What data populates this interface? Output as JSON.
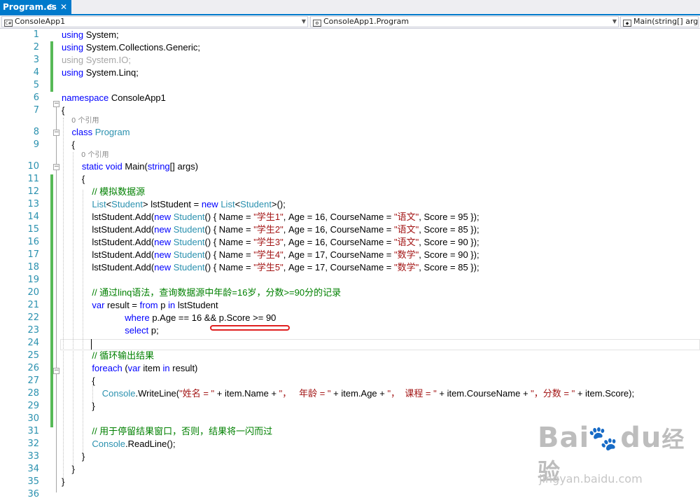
{
  "tab": {
    "title": "Program.cs",
    "pin_glyph": "⊕",
    "close_glyph": "✕"
  },
  "navbar": {
    "project_icon_text": "C#",
    "project": "ConsoleApp1",
    "type_member": "ConsoleApp1.Program",
    "method": "Main(string[] args)"
  },
  "codelens": [
    "0 个引用",
    "0 个引用"
  ],
  "lines": [
    {
      "n": "1",
      "t": [
        {
          "c": "kw",
          "s": "using"
        },
        {
          "c": "",
          "s": " System;"
        }
      ]
    },
    {
      "n": "2",
      "t": [
        {
          "c": "kw",
          "s": "using"
        },
        {
          "c": "",
          "s": " System.Collections.Generic;"
        }
      ]
    },
    {
      "n": "3",
      "t": [
        {
          "c": "dim",
          "s": "using System.IO;"
        }
      ]
    },
    {
      "n": "4",
      "t": [
        {
          "c": "kw",
          "s": "using"
        },
        {
          "c": "",
          "s": " System.Linq;"
        }
      ]
    },
    {
      "n": "5",
      "t": []
    },
    {
      "n": "6",
      "t": [
        {
          "c": "kw",
          "s": "namespace"
        },
        {
          "c": "",
          "s": " ConsoleApp1"
        }
      ]
    },
    {
      "n": "7",
      "t": [
        {
          "c": "",
          "s": "{"
        }
      ]
    },
    {
      "n": "8",
      "t": [
        {
          "c": "",
          "s": "    "
        },
        {
          "c": "kw",
          "s": "class"
        },
        {
          "c": "",
          "s": " "
        },
        {
          "c": "ty",
          "s": "Program"
        }
      ]
    },
    {
      "n": "9",
      "t": [
        {
          "c": "",
          "s": "    {"
        }
      ]
    },
    {
      "n": "10",
      "t": [
        {
          "c": "",
          "s": "        "
        },
        {
          "c": "kw",
          "s": "static"
        },
        {
          "c": "",
          "s": " "
        },
        {
          "c": "kw",
          "s": "void"
        },
        {
          "c": "",
          "s": " Main("
        },
        {
          "c": "kw",
          "s": "string"
        },
        {
          "c": "",
          "s": "[] args)"
        }
      ]
    },
    {
      "n": "11",
      "t": [
        {
          "c": "",
          "s": "        {"
        }
      ]
    },
    {
      "n": "12",
      "t": [
        {
          "c": "",
          "s": "            "
        },
        {
          "c": "cm",
          "s": "// 模拟数据源"
        }
      ]
    },
    {
      "n": "13",
      "t": [
        {
          "c": "",
          "s": "            "
        },
        {
          "c": "ty",
          "s": "List"
        },
        {
          "c": "",
          "s": "<"
        },
        {
          "c": "ty",
          "s": "Student"
        },
        {
          "c": "",
          "s": "> lstStudent = "
        },
        {
          "c": "kw",
          "s": "new"
        },
        {
          "c": "",
          "s": " "
        },
        {
          "c": "ty",
          "s": "List"
        },
        {
          "c": "",
          "s": "<"
        },
        {
          "c": "ty",
          "s": "Student"
        },
        {
          "c": "",
          "s": ">();"
        }
      ]
    },
    {
      "n": "14",
      "t": [
        {
          "c": "",
          "s": "            lstStudent.Add("
        },
        {
          "c": "kw",
          "s": "new"
        },
        {
          "c": "",
          "s": " "
        },
        {
          "c": "ty",
          "s": "Student"
        },
        {
          "c": "",
          "s": "() { Name = "
        },
        {
          "c": "st",
          "s": "\"学生1\""
        },
        {
          "c": "",
          "s": ", Age = 16, CourseName = "
        },
        {
          "c": "st",
          "s": "\"语文\""
        },
        {
          "c": "",
          "s": ", Score = 95 });"
        }
      ]
    },
    {
      "n": "15",
      "t": [
        {
          "c": "",
          "s": "            lstStudent.Add("
        },
        {
          "c": "kw",
          "s": "new"
        },
        {
          "c": "",
          "s": " "
        },
        {
          "c": "ty",
          "s": "Student"
        },
        {
          "c": "",
          "s": "() { Name = "
        },
        {
          "c": "st",
          "s": "\"学生2\""
        },
        {
          "c": "",
          "s": ", Age = 16, CourseName = "
        },
        {
          "c": "st",
          "s": "\"语文\""
        },
        {
          "c": "",
          "s": ", Score = 85 });"
        }
      ]
    },
    {
      "n": "16",
      "t": [
        {
          "c": "",
          "s": "            lstStudent.Add("
        },
        {
          "c": "kw",
          "s": "new"
        },
        {
          "c": "",
          "s": " "
        },
        {
          "c": "ty",
          "s": "Student"
        },
        {
          "c": "",
          "s": "() { Name = "
        },
        {
          "c": "st",
          "s": "\"学生3\""
        },
        {
          "c": "",
          "s": ", Age = 16, CourseName = "
        },
        {
          "c": "st",
          "s": "\"语文\""
        },
        {
          "c": "",
          "s": ", Score = 90 });"
        }
      ]
    },
    {
      "n": "17",
      "t": [
        {
          "c": "",
          "s": "            lstStudent.Add("
        },
        {
          "c": "kw",
          "s": "new"
        },
        {
          "c": "",
          "s": " "
        },
        {
          "c": "ty",
          "s": "Student"
        },
        {
          "c": "",
          "s": "() { Name = "
        },
        {
          "c": "st",
          "s": "\"学生4\""
        },
        {
          "c": "",
          "s": ", Age = 17, CourseName = "
        },
        {
          "c": "st",
          "s": "\"数学\""
        },
        {
          "c": "",
          "s": ", Score = 90 });"
        }
      ]
    },
    {
      "n": "18",
      "t": [
        {
          "c": "",
          "s": "            lstStudent.Add("
        },
        {
          "c": "kw",
          "s": "new"
        },
        {
          "c": "",
          "s": " "
        },
        {
          "c": "ty",
          "s": "Student"
        },
        {
          "c": "",
          "s": "() { Name = "
        },
        {
          "c": "st",
          "s": "\"学生5\""
        },
        {
          "c": "",
          "s": ", Age = 17, CourseName = "
        },
        {
          "c": "st",
          "s": "\"数学\""
        },
        {
          "c": "",
          "s": ", Score = 85 });"
        }
      ]
    },
    {
      "n": "19",
      "t": []
    },
    {
      "n": "20",
      "t": [
        {
          "c": "",
          "s": "            "
        },
        {
          "c": "cm",
          "s": "// 通过linq语法，查询数据源中年龄=16岁，分数>=90分的记录"
        }
      ]
    },
    {
      "n": "21",
      "t": [
        {
          "c": "",
          "s": "            "
        },
        {
          "c": "kw",
          "s": "var"
        },
        {
          "c": "",
          "s": " result = "
        },
        {
          "c": "kw",
          "s": "from"
        },
        {
          "c": "",
          "s": " p "
        },
        {
          "c": "kw",
          "s": "in"
        },
        {
          "c": "",
          "s": " lstStudent"
        }
      ]
    },
    {
      "n": "22",
      "t": [
        {
          "c": "",
          "s": "                         "
        },
        {
          "c": "kw",
          "s": "where"
        },
        {
          "c": "",
          "s": " p.Age == 16 && p.Score >= 90"
        }
      ]
    },
    {
      "n": "23",
      "t": [
        {
          "c": "",
          "s": "                         "
        },
        {
          "c": "kw",
          "s": "select"
        },
        {
          "c": "",
          "s": " p;"
        }
      ]
    },
    {
      "n": "24",
      "t": []
    },
    {
      "n": "25",
      "t": [
        {
          "c": "",
          "s": "            "
        },
        {
          "c": "cm",
          "s": "// 循环输出结果"
        }
      ]
    },
    {
      "n": "26",
      "t": [
        {
          "c": "",
          "s": "            "
        },
        {
          "c": "kw",
          "s": "foreach"
        },
        {
          "c": "",
          "s": " ("
        },
        {
          "c": "kw",
          "s": "var"
        },
        {
          "c": "",
          "s": " item "
        },
        {
          "c": "kw",
          "s": "in"
        },
        {
          "c": "",
          "s": " result)"
        }
      ]
    },
    {
      "n": "27",
      "t": [
        {
          "c": "",
          "s": "            {"
        }
      ]
    },
    {
      "n": "28",
      "t": [
        {
          "c": "",
          "s": "                "
        },
        {
          "c": "ty",
          "s": "Console"
        },
        {
          "c": "",
          "s": ".WriteLine("
        },
        {
          "c": "st",
          "s": "\"姓名 = \""
        },
        {
          "c": "",
          "s": " + item.Name + "
        },
        {
          "c": "st",
          "s": "\"，   年龄 = \""
        },
        {
          "c": "",
          "s": " + item.Age + "
        },
        {
          "c": "st",
          "s": "\"，  课程 = \""
        },
        {
          "c": "",
          "s": " + item.CourseName + "
        },
        {
          "c": "st",
          "s": "\"，分数 = \""
        },
        {
          "c": "",
          "s": " + item.Score);"
        }
      ]
    },
    {
      "n": "29",
      "t": [
        {
          "c": "",
          "s": "            }"
        }
      ]
    },
    {
      "n": "30",
      "t": []
    },
    {
      "n": "31",
      "t": [
        {
          "c": "",
          "s": "            "
        },
        {
          "c": "cm",
          "s": "// 用于停留结果窗口，否则，结果将一闪而过"
        }
      ]
    },
    {
      "n": "32",
      "t": [
        {
          "c": "",
          "s": "            "
        },
        {
          "c": "ty",
          "s": "Console"
        },
        {
          "c": "",
          "s": ".ReadLine();"
        }
      ]
    },
    {
      "n": "33",
      "t": [
        {
          "c": "",
          "s": "        }"
        }
      ]
    },
    {
      "n": "34",
      "t": [
        {
          "c": "",
          "s": "    }"
        }
      ]
    },
    {
      "n": "35",
      "t": [
        {
          "c": "",
          "s": "}"
        }
      ]
    },
    {
      "n": "36",
      "t": []
    }
  ],
  "watermark": {
    "brand_a": "Bai",
    "brand_b": "du",
    "brand_cn": "经验",
    "url": "jingyan.baidu.com"
  },
  "colors": {
    "keyword": "#0000ff",
    "type": "#2b91af",
    "string": "#a31515",
    "comment": "#008000",
    "accent": "#007acc"
  }
}
